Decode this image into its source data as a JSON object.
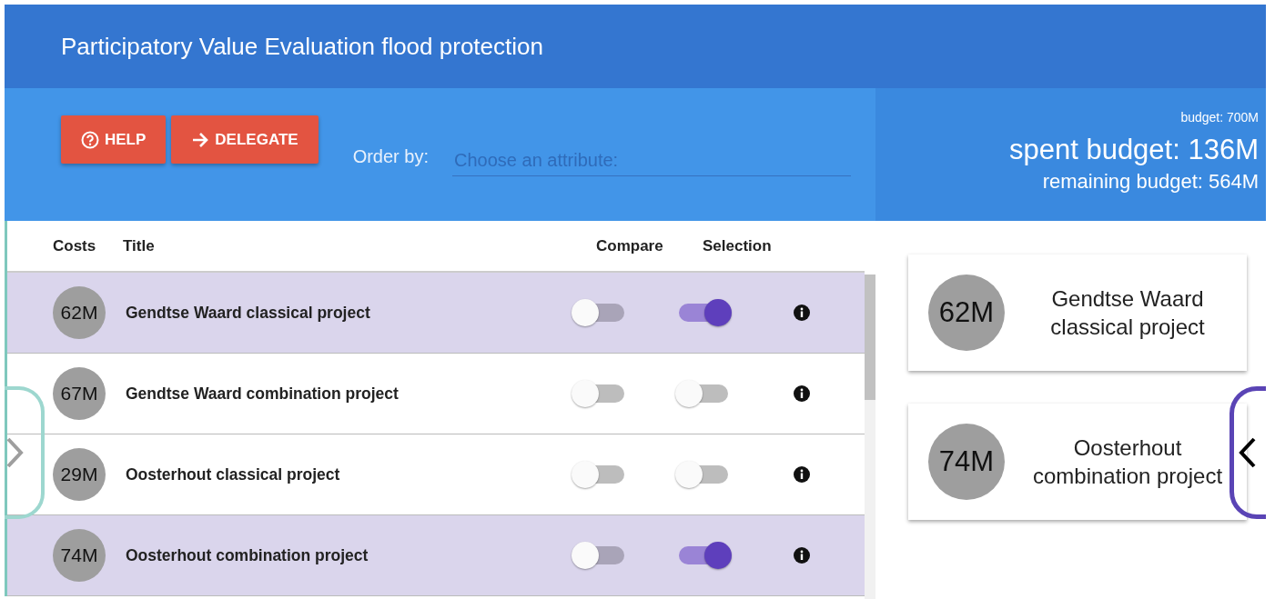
{
  "header": {
    "title": "Participatory Value Evaluation flood protection"
  },
  "toolbar": {
    "buttons": [
      {
        "kind": "help",
        "label": "HELP"
      },
      {
        "kind": "delegate",
        "label": "DELEGATE"
      }
    ],
    "order_label": "Order by:",
    "order_field": {
      "placeholder": "Choose an attribute:"
    }
  },
  "budget": {
    "total": "budget: 700M",
    "spent": "spent budget: 136M",
    "remaining": "remaining budget: 564M"
  },
  "table": {
    "columns": [
      "Costs",
      "Title",
      "Compare",
      "Selection"
    ],
    "rows": [
      {
        "cost": "62M",
        "title": "Gendtse Waard classical project",
        "compare": false,
        "selected": true
      },
      {
        "cost": "67M",
        "title": "Gendtse Waard combination project",
        "compare": false,
        "selected": false
      },
      {
        "cost": "29M",
        "title": "Oosterhout classical project",
        "compare": false,
        "selected": false
      },
      {
        "cost": "74M",
        "title": "Oosterhout combination project",
        "compare": false,
        "selected": true
      }
    ]
  },
  "selection_cards": [
    {
      "cost": "62M",
      "title": "Gendtse Waard classical project"
    },
    {
      "cost": "74M",
      "title": "Oosterhout combination project"
    }
  ]
}
